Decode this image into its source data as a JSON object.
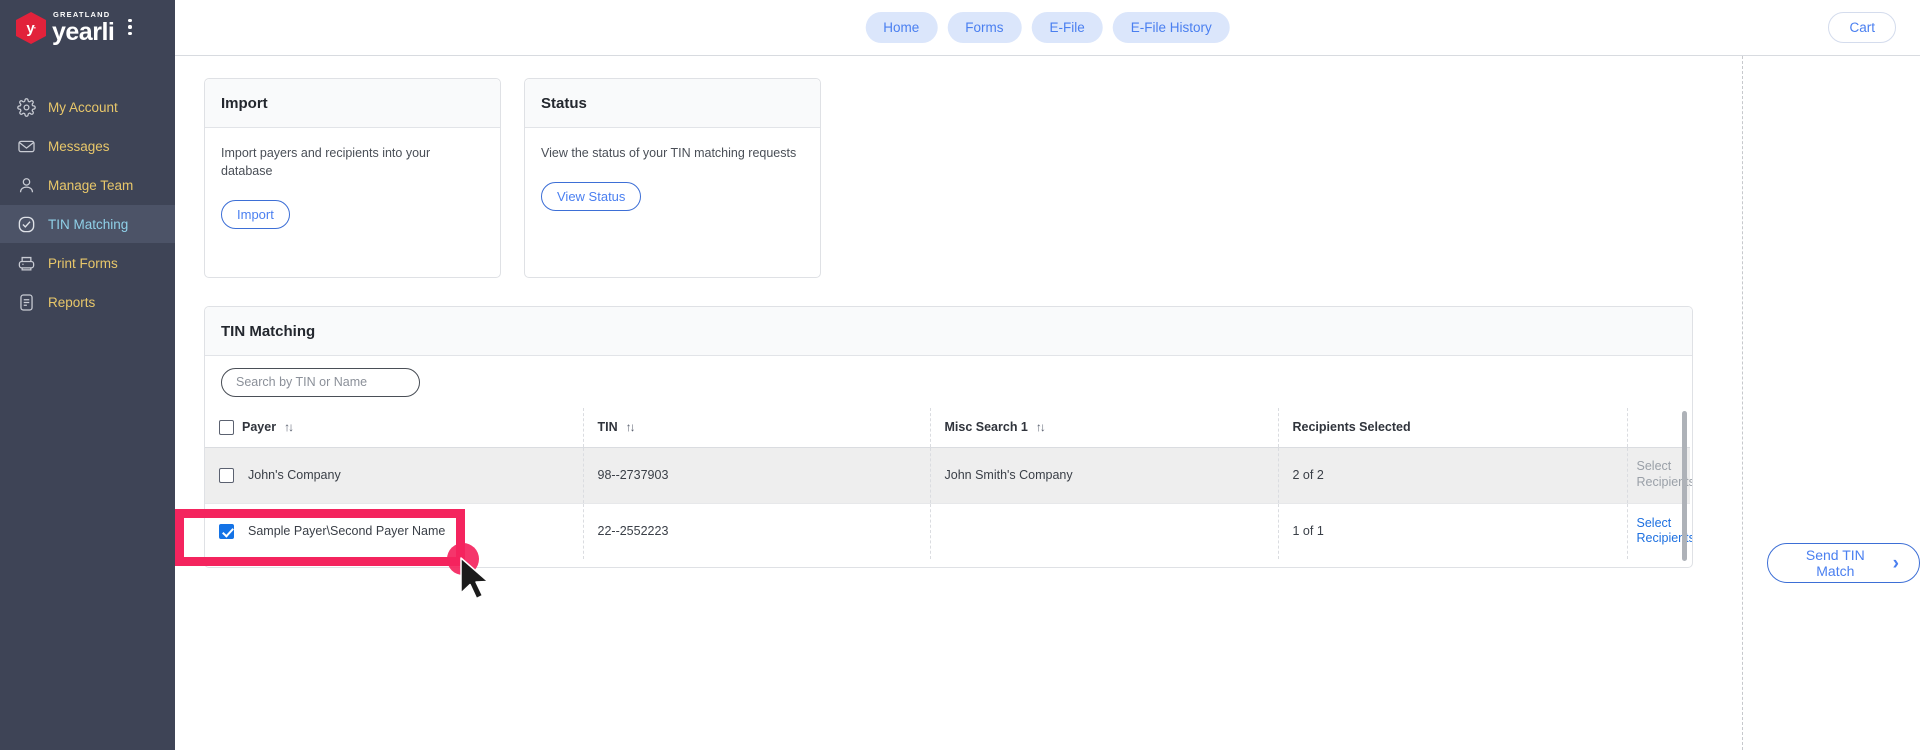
{
  "sidebar": {
    "brand": {
      "top": "GREATLAND",
      "name": "yearli",
      "kebab": "more-options"
    },
    "items": [
      {
        "label": "My Account",
        "icon": "gear-icon",
        "active": false
      },
      {
        "label": "Messages",
        "icon": "envelope-icon",
        "active": false
      },
      {
        "label": "Manage Team",
        "icon": "user-icon",
        "active": false
      },
      {
        "label": "TIN Matching",
        "icon": "check-circle-icon",
        "active": true
      },
      {
        "label": "Print Forms",
        "icon": "printer-icon",
        "active": false
      },
      {
        "label": "Reports",
        "icon": "document-icon",
        "active": false
      }
    ]
  },
  "topbar": {
    "nav": [
      {
        "label": "Home"
      },
      {
        "label": "Forms"
      },
      {
        "label": "E-File"
      },
      {
        "label": "E-File History"
      }
    ],
    "cart_label": "Cart"
  },
  "cards": [
    {
      "title": "Import",
      "text": "Import payers and recipients into your database",
      "button": "Import"
    },
    {
      "title": "Status",
      "text": "View the status of your TIN matching requests",
      "button": "View Status"
    }
  ],
  "tin_panel": {
    "title": "TIN Matching",
    "search_placeholder": "Search by TIN or Name",
    "search_value": "",
    "columns": [
      {
        "label": "Payer",
        "sortable": true
      },
      {
        "label": "TIN",
        "sortable": true
      },
      {
        "label": "Misc Search 1",
        "sortable": true
      },
      {
        "label": "Recipients Selected",
        "sortable": false
      },
      {
        "label": "",
        "sortable": false
      }
    ],
    "sort_glyph": "↑↓",
    "rows": [
      {
        "checked": false,
        "payer": "John's Company",
        "tin": "98--2737903",
        "misc1": "John Smith's Company",
        "recipients_selected": "2 of 2",
        "action": "Select Recipients",
        "action_enabled": false
      },
      {
        "checked": true,
        "payer": "Sample Payer\\Second Payer Name",
        "tin": "22--2552223",
        "misc1": "",
        "recipients_selected": "1 of 1",
        "action": "Select Recipients",
        "action_enabled": true
      }
    ]
  },
  "send_button": {
    "label": "Send TIN Match",
    "chevron": "›"
  },
  "colors": {
    "sidebar_bg": "#3e4456",
    "sidebar_active": "#4c5367",
    "brand_red": "#e2223b",
    "nav_text": "#e8c76a",
    "accent_blue": "#4a7ff0",
    "pill_bg": "#dbe6fb",
    "checkbox_blue": "#1473e6",
    "highlight_pink": "#f4245e",
    "row_stripe": "#eeeeee"
  }
}
